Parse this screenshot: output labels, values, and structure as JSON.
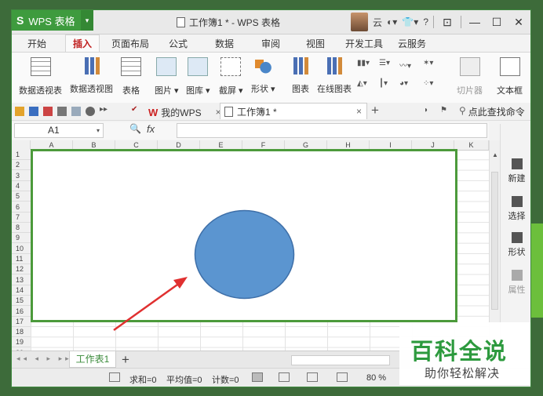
{
  "titlebar": {
    "app_name": "WPS 表格",
    "logo_glyph": "S",
    "window_title": "工作簿1 * - WPS 表格",
    "cloud_label": "云",
    "help_label": "?",
    "minimize": "—",
    "maximize": "☐",
    "close": "✕"
  },
  "menu": {
    "tabs": [
      "开始",
      "插入",
      "页面布局",
      "公式",
      "数据",
      "审阅",
      "视图",
      "开发工具",
      "云服务"
    ],
    "active_index": 1
  },
  "ribbon": {
    "items": [
      {
        "label": "数据透视表",
        "icon": "pivot-table-icon"
      },
      {
        "label": "数据透视图",
        "icon": "pivot-chart-icon"
      },
      {
        "label": "表格",
        "icon": "table-icon"
      },
      {
        "label": "图片 ▾",
        "icon": "picture-icon"
      },
      {
        "label": "图库 ▾",
        "icon": "gallery-icon"
      },
      {
        "label": "截屏 ▾",
        "icon": "screenshot-icon"
      },
      {
        "label": "形状 ▾",
        "icon": "shape-icon"
      },
      {
        "label": "图表",
        "icon": "chart-icon"
      },
      {
        "label": "在线图表",
        "icon": "online-chart-icon"
      },
      {
        "label": "切片器",
        "icon": "slicer-icon"
      },
      {
        "label": "文本框",
        "icon": "textbox-icon"
      }
    ]
  },
  "quickbar": {
    "wps_tab_label": "我的WPS",
    "doc_tab_label": "工作簿1 *",
    "close_glyph": "×",
    "add_glyph": "+",
    "search_label": "点此查找命令"
  },
  "formula": {
    "cell_ref": "A1",
    "fx_label": "fx",
    "zoom_glyph": "🔍",
    "value": ""
  },
  "grid": {
    "columns": [
      "A",
      "B",
      "C",
      "D",
      "E",
      "F",
      "G",
      "H",
      "I",
      "J",
      "K"
    ],
    "rows": [
      "1",
      "2",
      "3",
      "4",
      "5",
      "6",
      "7",
      "8",
      "9",
      "10",
      "11",
      "12",
      "13",
      "14",
      "15",
      "16",
      "17",
      "18",
      "19",
      "20"
    ]
  },
  "right_pane": {
    "items": [
      {
        "label": "新建",
        "icon": "new-icon",
        "dim": false
      },
      {
        "label": "选择",
        "icon": "select-icon",
        "dim": false
      },
      {
        "label": "形状",
        "icon": "shape-icon",
        "dim": false
      },
      {
        "label": "属性",
        "icon": "property-icon",
        "dim": true
      }
    ]
  },
  "sheets": {
    "tabs": [
      "工作表1"
    ],
    "add_glyph": "+",
    "nav_arrows": "◂◂ ◂ ▸ ▸▸"
  },
  "status": {
    "sum": "求和=0",
    "average": "平均值=0",
    "count": "计数=0",
    "zoom": "80 %"
  },
  "watermark": {
    "title": "百科全说",
    "subtitle": "助你轻松解决"
  },
  "colors": {
    "accent_green": "#3e9b3e",
    "selection_border": "#4c9a3b",
    "ellipse_fill": "#5b95d0",
    "arrow": "#e03030",
    "watermark_green": "#2d9a3e"
  }
}
